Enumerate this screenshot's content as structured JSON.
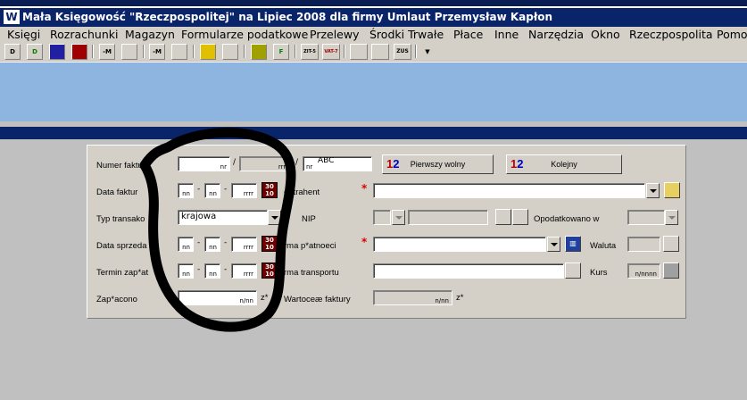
{
  "window": {
    "title": "Mała Księgowość \"Rzeczpospolitej\" na Lipiec 2008 dla firmy Umlaut Przemysław Kapłon"
  },
  "menu": [
    "Księgi",
    "Rozrachunki",
    "Magazyn",
    "Formularze podatkowe",
    "Przelewy",
    "Środki Trwałe",
    "Płace",
    "Inne",
    "Narzędzia",
    "Okno",
    "Rzeczpospolita",
    "Pomo"
  ],
  "toolbar": {
    "icons": [
      "D",
      "D",
      "",
      "",
      "-M",
      "",
      "-M",
      "",
      "",
      "",
      "",
      "F",
      "ZIT-5",
      "VAT-7",
      "",
      "",
      "ZUS",
      ""
    ]
  },
  "form": {
    "numer_label": "Numer faktu",
    "numer_placeholder": "nr",
    "numer_sep1": "/",
    "numer_part2": "rrrr",
    "numer_sep2": "/",
    "numer_suffix": "ABC",
    "numer_suffix_hint": "nr",
    "btn_pierwszy": "Pierwszy wolny",
    "btn_kolejny": "Kolejny",
    "btn_icon_digits": [
      "1",
      "2"
    ],
    "data_faktury_label": "Data faktur",
    "kontrahent_label": "ontrahent",
    "typ_label": "Typ transako",
    "typ_value": "krajowa",
    "nip_label": "NIP",
    "opodatkowano_label": "Opodatkowano w",
    "data_sprzedazy_label": "Data sprzeda",
    "forma_platnosci_label": "rma p*atnoeci",
    "waluta_label": "Waluta",
    "termin_label": "Termin zap*at",
    "forma_transportu_label": "rma transportu",
    "kurs_label": "Kurs",
    "kurs_placeholder": "n/nnnn",
    "zaplacono_label": "Zap*acono",
    "zaplacono_placeholder": "n/nn",
    "zaplacono_unit": "z*",
    "wartosc_label": "Wartoceæ faktury",
    "wartosc_placeholder": "n/nn",
    "wartosc_unit": "z*",
    "date_dd": "nn",
    "date_mm": "nn",
    "date_yyyy": "rrrr",
    "date_sep": "-",
    "required_mark": "*"
  }
}
